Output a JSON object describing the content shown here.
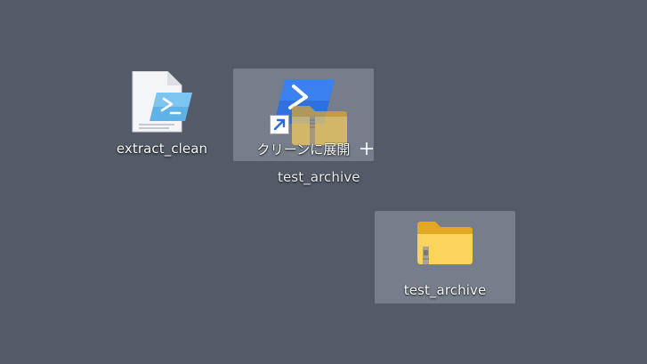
{
  "desktop": {
    "background_color": "#535b68",
    "icons": [
      {
        "name": "extract_clean",
        "label": "extract_clean",
        "type": "powershell-script-file",
        "selected": false
      },
      {
        "name": "クリーンに展開",
        "label": "クリーンに展開",
        "type": "powershell-shortcut",
        "selected": true,
        "drop_target": true
      },
      {
        "name": "test_archive",
        "label": "test_archive",
        "type": "zip-folder",
        "selected": true
      }
    ],
    "drag": {
      "ghost_label": "test_archive",
      "cursor": "plus-cursor-icon"
    }
  }
}
